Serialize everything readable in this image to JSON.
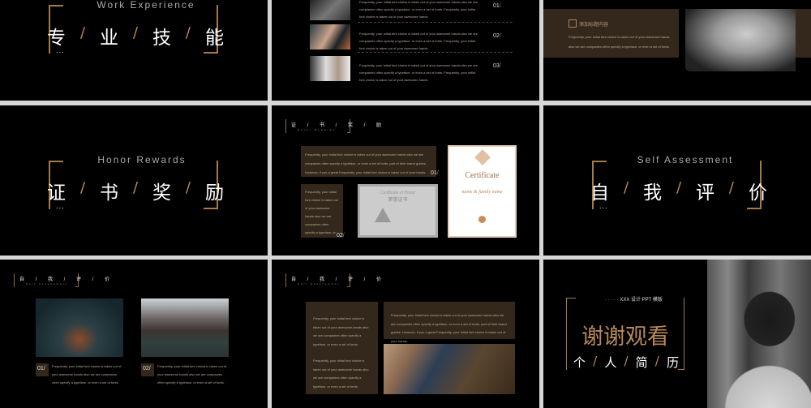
{
  "slides": {
    "work": {
      "subtitle": "Work Experience",
      "chars": [
        "专",
        "业",
        "技",
        "能"
      ],
      "sep": "/",
      "dots": "..."
    },
    "list": {
      "items": [
        {
          "text": "Frequently, your initial font choice is taken out of your awesome hands also we are companies often specify a typeface, or even a set of fonts. Frequently, your initial font choice is taken out of your awesome hands",
          "num": "01",
          "sep": "/"
        },
        {
          "text": "Frequently, your initial font choice is taken out of your awesome hands also we are companies often specify a typeface, or even a set of fonts. Frequently, your initial font choice is taken out of your awesome hands",
          "num": "02",
          "sep": "/"
        },
        {
          "text": "Frequently, your initial font choice is taken out of your awesome hands also we are companies often specify a typeface, or even a set of fonts. Frequently, your initial font choice is taken out of your awesome hands",
          "num": "03",
          "sep": "/"
        }
      ]
    },
    "feature": {
      "title": "添加标题内容",
      "text": "Frequently, your initial font choice is taken out of your awesome hands also we are companies often specify a typeface, or even a set of fonts."
    },
    "honor": {
      "subtitle": "Honor Rewards",
      "chars": [
        "证",
        "书",
        "奖",
        "励"
      ],
      "sep": "/",
      "dots": "..."
    },
    "certs": {
      "title": "证 / 书 / 奖 / 励",
      "title_sub": "Honor Rewards",
      "box1": "Frequently, your initial font choice is taken out of your awesome hands also we are companies often specify a typeface, or even a set of fonts,  part of their brand guides. However, if you a great Frequently, your initial font choice is taken out of your hands.",
      "num1": "01",
      "box2": "Frequently, your initial font choice is taken out of your awesome hands also we are companies often specify a typeface, or even a set of fonts.",
      "num2": "02",
      "sep": "/",
      "cert1_title": "Certificate of Honor",
      "cert1_cn": "荣誉证书",
      "cert2_title": "Certificate",
      "cert2_name": "name & family name"
    },
    "self": {
      "subtitle": "Self Assessment",
      "chars": [
        "自",
        "我",
        "评",
        "价"
      ],
      "sep": "/",
      "dots": "..."
    },
    "self2": {
      "title": "自 / 我 / 评 / 价",
      "title_sub": "Self Assessment",
      "items": [
        {
          "num": "01",
          "sep": "/",
          "text": "Frequently, your initial font choice is taken out of your awesome hands also we are companies often specify a typeface, or even a set of fonts ."
        },
        {
          "num": "02",
          "sep": "/",
          "text": "Frequently, your initial font choice is taken out of your awesome hands also we are companies often specify a typeface, or even a set of fonts ."
        }
      ]
    },
    "self3": {
      "title": "自 / 我 / 评 / 价",
      "title_sub": "Self Assessment",
      "left1": "Frequently, your initial font choice is taken out of your awesome hands also we are companies often specify a typeface, or even a set of fonts.",
      "left2": "Frequently, your initial font choice is taken out of your awesome hands also we are companies often specify a typeface, or even a set of fonts.",
      "right": "Frequently, your initial font choice is taken out of your awesome hands also we are companies often specify a typeface, or even a set of fonts.  part of their brand guides. However, if you a great Frequently, your initial font choice is taken out of your hands."
    },
    "thanks": {
      "tagline": "· · · · · XXX 设计 PPT 模版",
      "title": "谢谢观看",
      "chars": [
        "个",
        "人",
        "简",
        "历"
      ],
      "sep": "/"
    }
  },
  "colors": {
    "gold": "#b8885a",
    "brown": "#33281b"
  }
}
